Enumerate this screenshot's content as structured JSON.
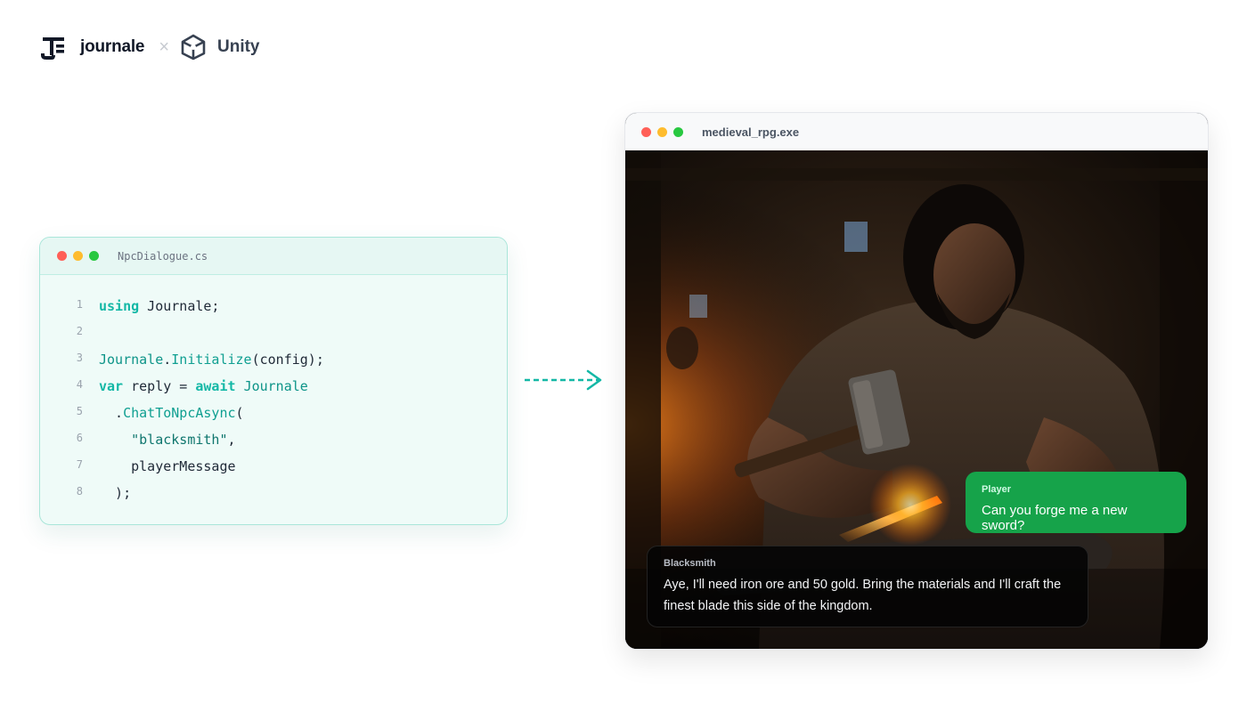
{
  "header": {
    "brand_name": "journale",
    "separator": "×",
    "partner_name": "Unity"
  },
  "code_window": {
    "filename": "NpcDialogue.cs",
    "lines": [
      {
        "num": "1",
        "parts": [
          "using",
          " Journale;"
        ]
      },
      {
        "num": "2"
      },
      {
        "num": "3",
        "parts": [
          "Journale",
          ".",
          "Initialize",
          "(config);"
        ]
      },
      {
        "num": "4",
        "parts": [
          "var",
          " reply = ",
          "await",
          " ",
          "Journale"
        ]
      },
      {
        "num": "5",
        "parts": [
          "  .",
          "ChatToNpcAsync",
          "("
        ]
      },
      {
        "num": "6",
        "parts": [
          "    ",
          "\"blacksmith\"",
          ","
        ]
      },
      {
        "num": "7",
        "parts": [
          "    playerMessage"
        ]
      },
      {
        "num": "8",
        "parts": [
          "  );"
        ]
      }
    ]
  },
  "game_window": {
    "title": "medieval_rpg.exe",
    "player_bubble": {
      "speaker": "Player",
      "message": "Can you forge me a new sword?"
    },
    "npc_bubble": {
      "speaker": "Blacksmith",
      "message": "Aye, I'll need iron ore and 50 gold. Bring the materials and I'll craft the finest blade this side of the kingdom."
    }
  },
  "colors": {
    "accent_teal": "#14b8a6",
    "player_green": "#16a34a"
  }
}
